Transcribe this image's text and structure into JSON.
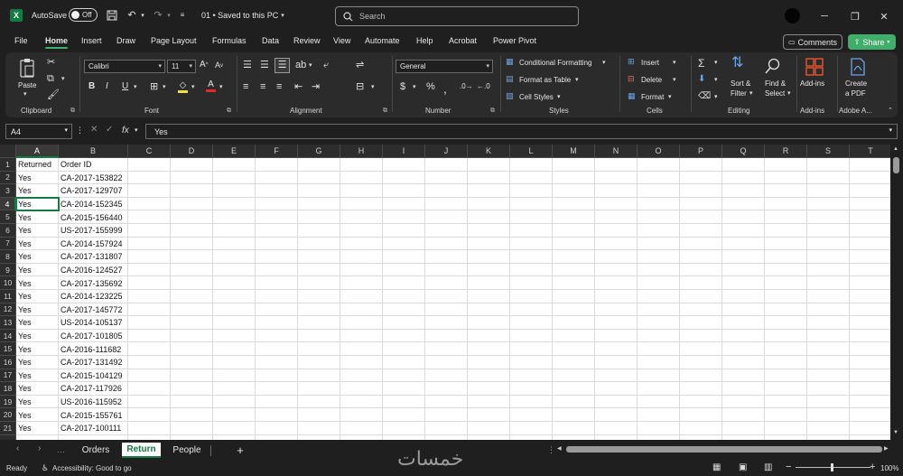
{
  "titlebar": {
    "autosave_label": "AutoSave",
    "autosave_state": "Off",
    "file_title": "01 • Saved to this PC",
    "search_placeholder": "Search"
  },
  "menu": {
    "items": [
      "File",
      "Home",
      "Insert",
      "Draw",
      "Page Layout",
      "Formulas",
      "Data",
      "Review",
      "View",
      "Automate",
      "Help",
      "Acrobat",
      "Power Pivot"
    ],
    "active": "Home",
    "comments_label": "Comments",
    "share_label": "Share"
  },
  "ribbon": {
    "clipboard": {
      "paste_label": "Paste",
      "group_label": "Clipboard"
    },
    "font": {
      "font_name": "Calibri",
      "font_size": "11",
      "group_label": "Font"
    },
    "alignment": {
      "group_label": "Alignment"
    },
    "number": {
      "format": "General",
      "group_label": "Number"
    },
    "styles": {
      "conditional": "Conditional Formatting",
      "format_table": "Format as Table",
      "cell_styles": "Cell Styles",
      "group_label": "Styles"
    },
    "cells": {
      "insert": "Insert",
      "delete": "Delete",
      "format": "Format",
      "group_label": "Cells"
    },
    "editing": {
      "sort_filter_1": "Sort &",
      "sort_filter_2": "Filter",
      "find_select_1": "Find &",
      "find_select_2": "Select",
      "group_label": "Editing"
    },
    "addins": {
      "label": "Add-ins",
      "group_label": "Add-ins"
    },
    "adobe": {
      "label_1": "Create",
      "label_2": "a PDF",
      "group_label": "Adobe A..."
    }
  },
  "formula_bar": {
    "name_box": "A4",
    "fx": "fx",
    "content": "Yes"
  },
  "sheet": {
    "columns": [
      "A",
      "B",
      "C",
      "D",
      "E",
      "F",
      "G",
      "H",
      "I",
      "J",
      "K",
      "L",
      "M",
      "N",
      "O",
      "P",
      "Q",
      "R",
      "S",
      "T"
    ],
    "rows": [
      [
        "1",
        "Returned",
        "Order ID"
      ],
      [
        "2",
        "Yes",
        "CA-2017-153822"
      ],
      [
        "3",
        "Yes",
        "CA-2017-129707"
      ],
      [
        "4",
        "Yes",
        "CA-2014-152345"
      ],
      [
        "5",
        "Yes",
        "CA-2015-156440"
      ],
      [
        "6",
        "Yes",
        "US-2017-155999"
      ],
      [
        "7",
        "Yes",
        "CA-2014-157924"
      ],
      [
        "8",
        "Yes",
        "CA-2017-131807"
      ],
      [
        "9",
        "Yes",
        "CA-2016-124527"
      ],
      [
        "10",
        "Yes",
        "CA-2017-135692"
      ],
      [
        "11",
        "Yes",
        "CA-2014-123225"
      ],
      [
        "12",
        "Yes",
        "CA-2017-145772"
      ],
      [
        "13",
        "Yes",
        "US-2014-105137"
      ],
      [
        "14",
        "Yes",
        "CA-2017-101805"
      ],
      [
        "15",
        "Yes",
        "CA-2016-111682"
      ],
      [
        "16",
        "Yes",
        "CA-2017-131492"
      ],
      [
        "17",
        "Yes",
        "CA-2015-104129"
      ],
      [
        "18",
        "Yes",
        "CA-2017-117926"
      ],
      [
        "19",
        "Yes",
        "US-2016-115952"
      ],
      [
        "20",
        "Yes",
        "CA-2015-155761"
      ],
      [
        "21",
        "Yes",
        "CA-2017-100111"
      ]
    ],
    "selected_cell": "A4"
  },
  "tabs": {
    "sheets": [
      "Orders",
      "Return",
      "People"
    ],
    "active": "Return",
    "add_label": "+"
  },
  "status": {
    "ready": "Ready",
    "accessibility": "Accessibility: Good to go",
    "zoom": "100%"
  },
  "watermark": "خمسات",
  "colors": {
    "accent": "#107c41",
    "share_button": "#3fae6a",
    "background": "#1f1f1f",
    "ribbon": "#2b2b2b"
  }
}
